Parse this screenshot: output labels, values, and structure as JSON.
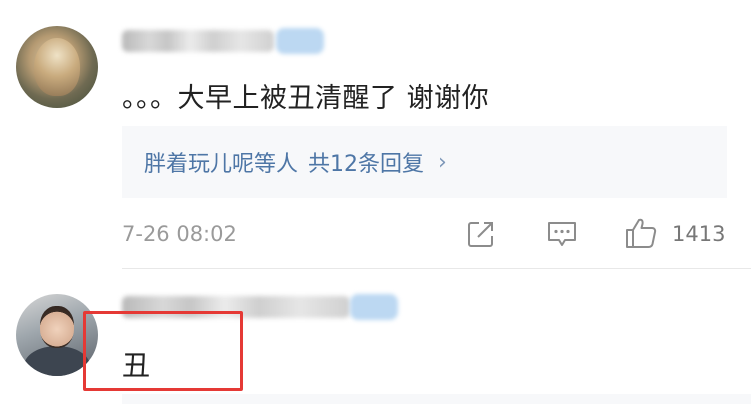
{
  "comment1": {
    "text": "。。。大早上被丑清醒了 谢谢你",
    "replies": {
      "users": "胖着玩儿呢等人",
      "count_text": "共12条回复",
      "chevron": "›"
    },
    "time": "7-26 08:02",
    "like_count": "1413",
    "icons": [
      "share-icon",
      "comment-icon",
      "thumbs-up-icon"
    ]
  },
  "comment2": {
    "text": "丑"
  },
  "colors": {
    "link_blue": "#4e76a6",
    "highlight_red": "#e53935",
    "reply_bg": "#f7f8fa"
  }
}
